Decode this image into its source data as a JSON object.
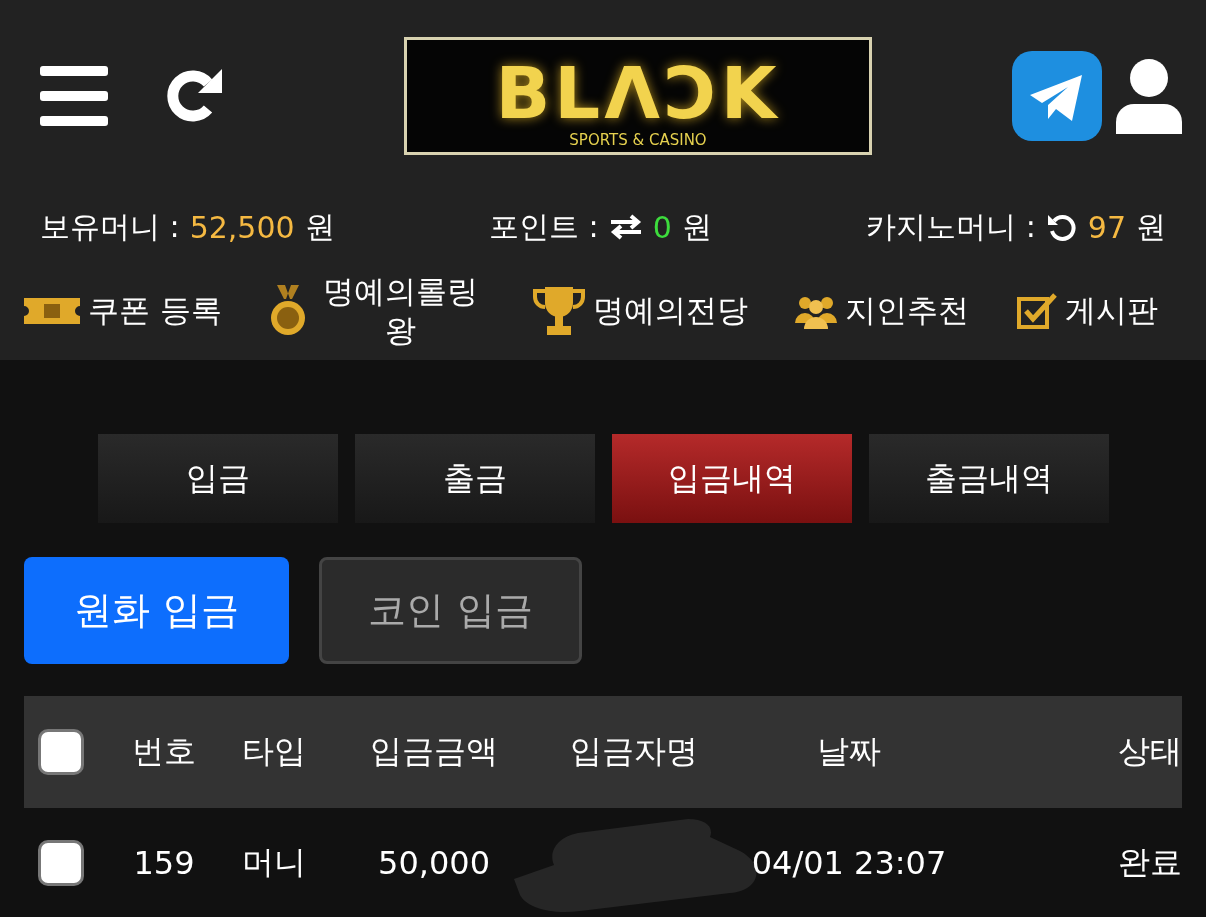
{
  "header": {
    "logo": {
      "title": "BLΛƆK",
      "subtitle": "SPORTS & CASINO"
    }
  },
  "balances": [
    {
      "label": "보유머니 :",
      "kind": "plain",
      "value": "52,500",
      "unit": "원",
      "color": "#f5b942"
    },
    {
      "label": "포인트 :",
      "kind": "exchange",
      "value": "0",
      "unit": "원",
      "color": "#3ddc3d"
    },
    {
      "label": "카지노머니 :",
      "kind": "refresh",
      "value": "97",
      "unit": "원",
      "color": "#f5b942"
    }
  ],
  "menu": [
    {
      "kind": "ticket",
      "label": "쿠폰 등록"
    },
    {
      "kind": "medal",
      "label": "명예의롤링왕"
    },
    {
      "kind": "trophy",
      "label": "명예의전당"
    },
    {
      "kind": "people",
      "label": "지인추천"
    },
    {
      "kind": "board",
      "label": "게시판"
    }
  ],
  "tabs": [
    {
      "label": "입금",
      "selected": false
    },
    {
      "label": "출금",
      "selected": false
    },
    {
      "label": "입금내역",
      "selected": true
    },
    {
      "label": "출금내역",
      "selected": false
    }
  ],
  "currency_tabs": [
    {
      "label": "원화 입금",
      "selected": true
    },
    {
      "label": "코인 입금",
      "selected": false
    }
  ],
  "table": {
    "select_all": {
      "checked": false
    },
    "columns": [
      "번호",
      "타입",
      "입금금액",
      "입금자명",
      "날짜",
      "상태"
    ],
    "rows": [
      {
        "checked": false,
        "cells": [
          "159",
          "머니",
          "50,000",
          null,
          "04/01 23:07",
          "완료"
        ]
      }
    ]
  }
}
